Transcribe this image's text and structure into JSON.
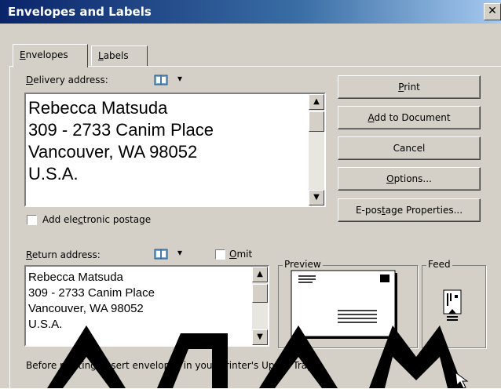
{
  "window": {
    "title": "Envelopes and Labels",
    "close_glyph": "✕"
  },
  "tabs": [
    {
      "label_pre": "",
      "label_u": "E",
      "label_post": "nvelopes"
    },
    {
      "label_pre": "",
      "label_u": "L",
      "label_post": "abels"
    }
  ],
  "delivery": {
    "label_u": "D",
    "label_post": "elivery address:",
    "lines": [
      "Rebecca Matsuda",
      "309 - 2733 Canim Place",
      "Vancouver, WA 98052",
      "U.S.A."
    ]
  },
  "postage": {
    "pre": "Add ele",
    "u": "c",
    "post": "tronic postage"
  },
  "return": {
    "label_u": "R",
    "label_post": "eturn address:",
    "lines": [
      "Rebecca Matsuda",
      "309 - 2733 Canim Place",
      "Vancouver, WA 98052",
      "U.S.A."
    ]
  },
  "omit": {
    "pre": "O",
    "u": "m",
    "post": "it"
  },
  "buttons": {
    "print": {
      "u": "P",
      "post": "rint"
    },
    "add": {
      "u": "A",
      "post": "dd to Document"
    },
    "cancel": "Cancel",
    "options": {
      "u": "O",
      "post": "ptions..."
    },
    "epostage": {
      "pre": "E-pos",
      "u": "t",
      "post": "age Properties..."
    }
  },
  "preview_title": "Preview",
  "feed_title": "Feed",
  "footer_text": "Before printing, insert envelopes in your printer's Upper Tray.",
  "icons": {
    "address_book": "address-book-icon",
    "dropdown": "▾"
  }
}
